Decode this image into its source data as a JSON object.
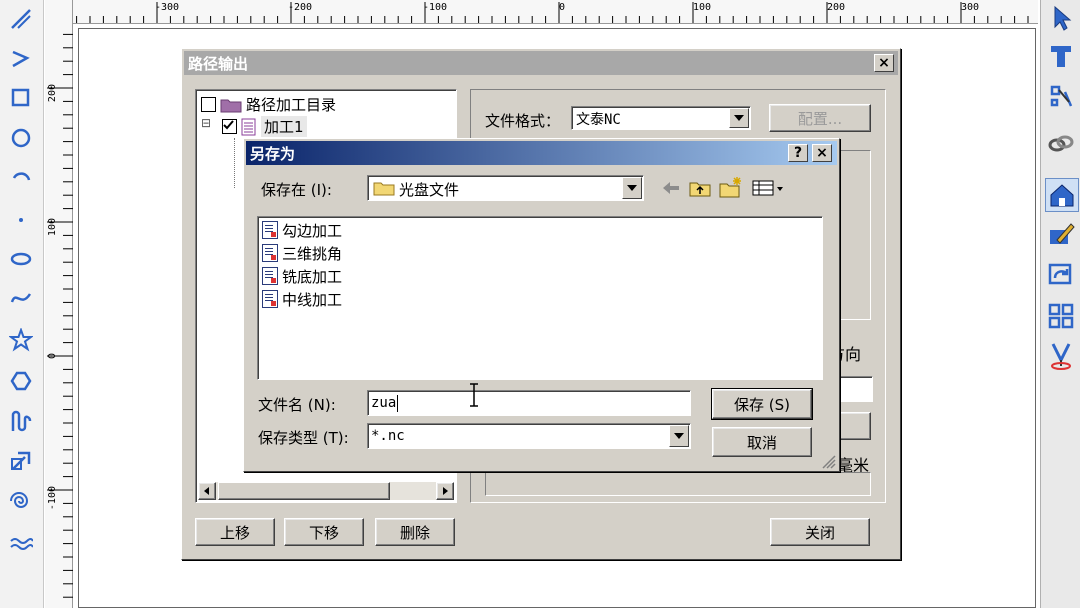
{
  "ruler": {
    "h_labels": [
      "-300",
      "-200",
      "-100",
      "0",
      "100",
      "200",
      "300"
    ],
    "v_labels": [
      "200",
      "100",
      "0",
      "-100"
    ]
  },
  "icons": {
    "left": [
      "line-tool-icon",
      "polyline-tool-icon",
      "rectangle-tool-icon",
      "circle-tool-icon",
      "arc-tool-icon",
      "point-tool-icon",
      "ellipse-tool-icon",
      "spline-tool-icon",
      "star-tool-icon",
      "polygon-tool-icon",
      "hook-tool-icon",
      "arrow-tool-icon",
      "spiral-tool-icon",
      "wave-tool-icon"
    ],
    "right": [
      "select-pointer-icon",
      "text-tool-icon",
      "node-edit-icon",
      "chain-icon",
      "home-view-icon",
      "draw-edit-icon",
      "rotate-view-icon",
      "grid-layout-icon",
      "tool-path-icon"
    ]
  },
  "path_output": {
    "title": "路径输出",
    "close": "×",
    "tree": {
      "root": "路径加工目录",
      "child": "加工1",
      "expander": "⊟"
    },
    "file_format_label": "文件格式：",
    "file_format_value": "文泰NC",
    "config_button": "配置...",
    "partial_text_1": "方向",
    "partial_text_2": "毫米",
    "buttons": {
      "move_up": "上移",
      "move_down": "下移",
      "delete": "删除",
      "close": "关闭"
    }
  },
  "save_as": {
    "title": "另存为",
    "help": "?",
    "close": "×",
    "save_in_label": "保存在 (I):",
    "save_in_value": "光盘文件",
    "files": [
      "勾边加工",
      "三维挑角",
      "铣底加工",
      "中线加工"
    ],
    "filename_label": "文件名 (N):",
    "filename_value": "zua",
    "filetype_label": "保存类型 (T):",
    "filetype_value": "*.nc",
    "save_button": "保存 (S)",
    "cancel_button": "取消"
  },
  "colors": {
    "dialog_face": "#d4d0c8",
    "title_blue": "#0a246a",
    "title_gray": "#a8a8a8",
    "tool_blue": "#2f66c8"
  }
}
